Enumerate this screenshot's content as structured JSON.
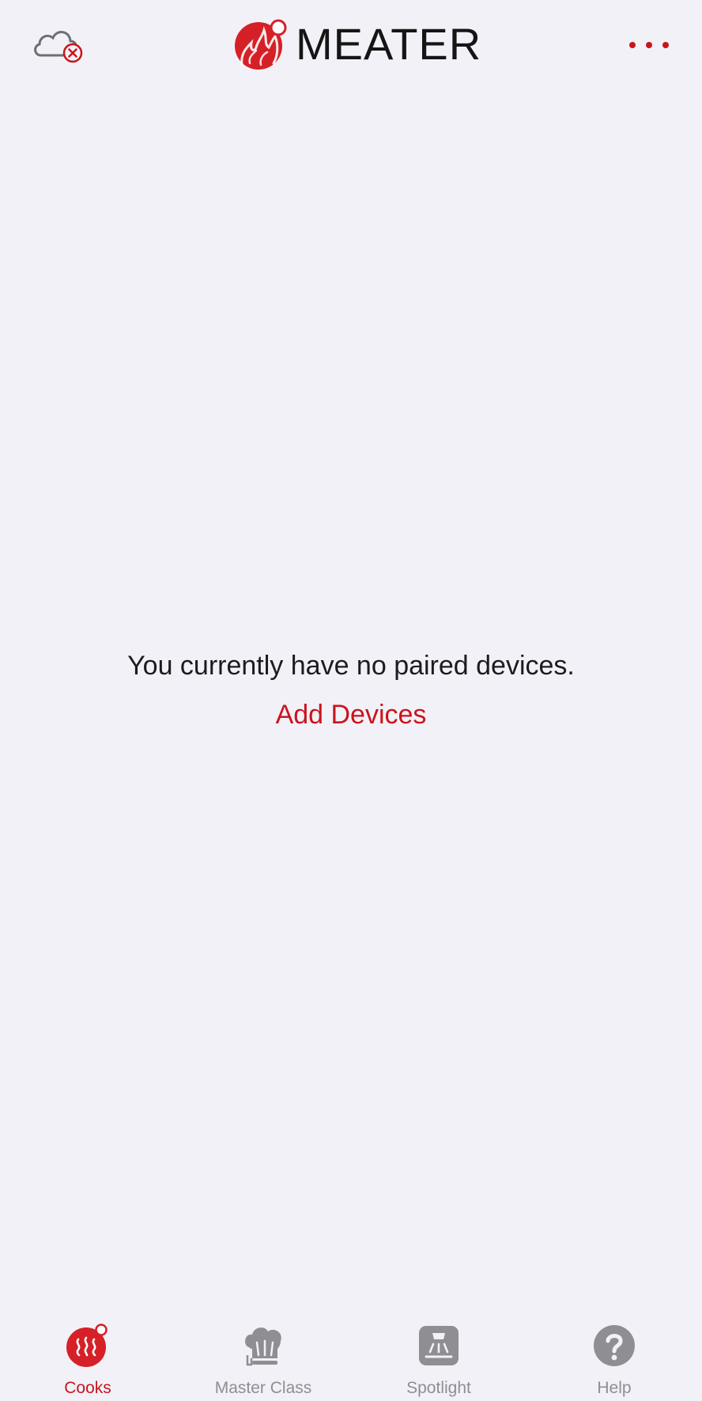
{
  "header": {
    "app_title": "MEATER",
    "cloud_icon": "cloud-disconnected-icon",
    "more_icon": "more-dots-icon"
  },
  "empty_state": {
    "message": "You currently have no paired devices.",
    "action_label": "Add Devices"
  },
  "tabbar": {
    "tabs": [
      {
        "label": "Cooks",
        "icon": "cooks-icon",
        "active": true
      },
      {
        "label": "Master Class",
        "icon": "chef-hat-icon",
        "active": false
      },
      {
        "label": "Spotlight",
        "icon": "spotlight-icon",
        "active": false
      },
      {
        "label": "Help",
        "icon": "help-icon",
        "active": false
      }
    ]
  },
  "colors": {
    "accent": "#c8151b",
    "background": "#f2f1f7",
    "inactive": "#8e8e93",
    "text": "#1c1c1e"
  }
}
